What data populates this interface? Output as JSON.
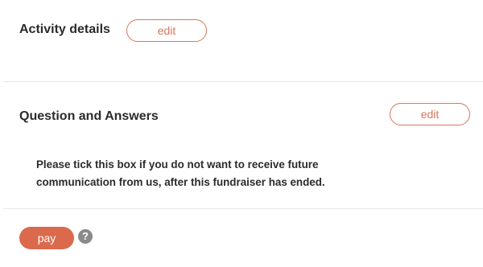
{
  "activity": {
    "title": "Activity details",
    "edit_label": "edit"
  },
  "qa": {
    "title": "Question and Answers",
    "edit_label": "edit",
    "notice_text": "Please tick this box if you do not want to receive future communication from us, after this fundraiser has ended."
  },
  "footer": {
    "pay_label": "pay",
    "help_icon": "question-circle-icon",
    "help_glyph": "?"
  },
  "colors": {
    "accent": "#d9765a",
    "pay_background": "#db6a4d",
    "help_icon": "#8a8a8a",
    "divider": "#e6e6e6"
  }
}
